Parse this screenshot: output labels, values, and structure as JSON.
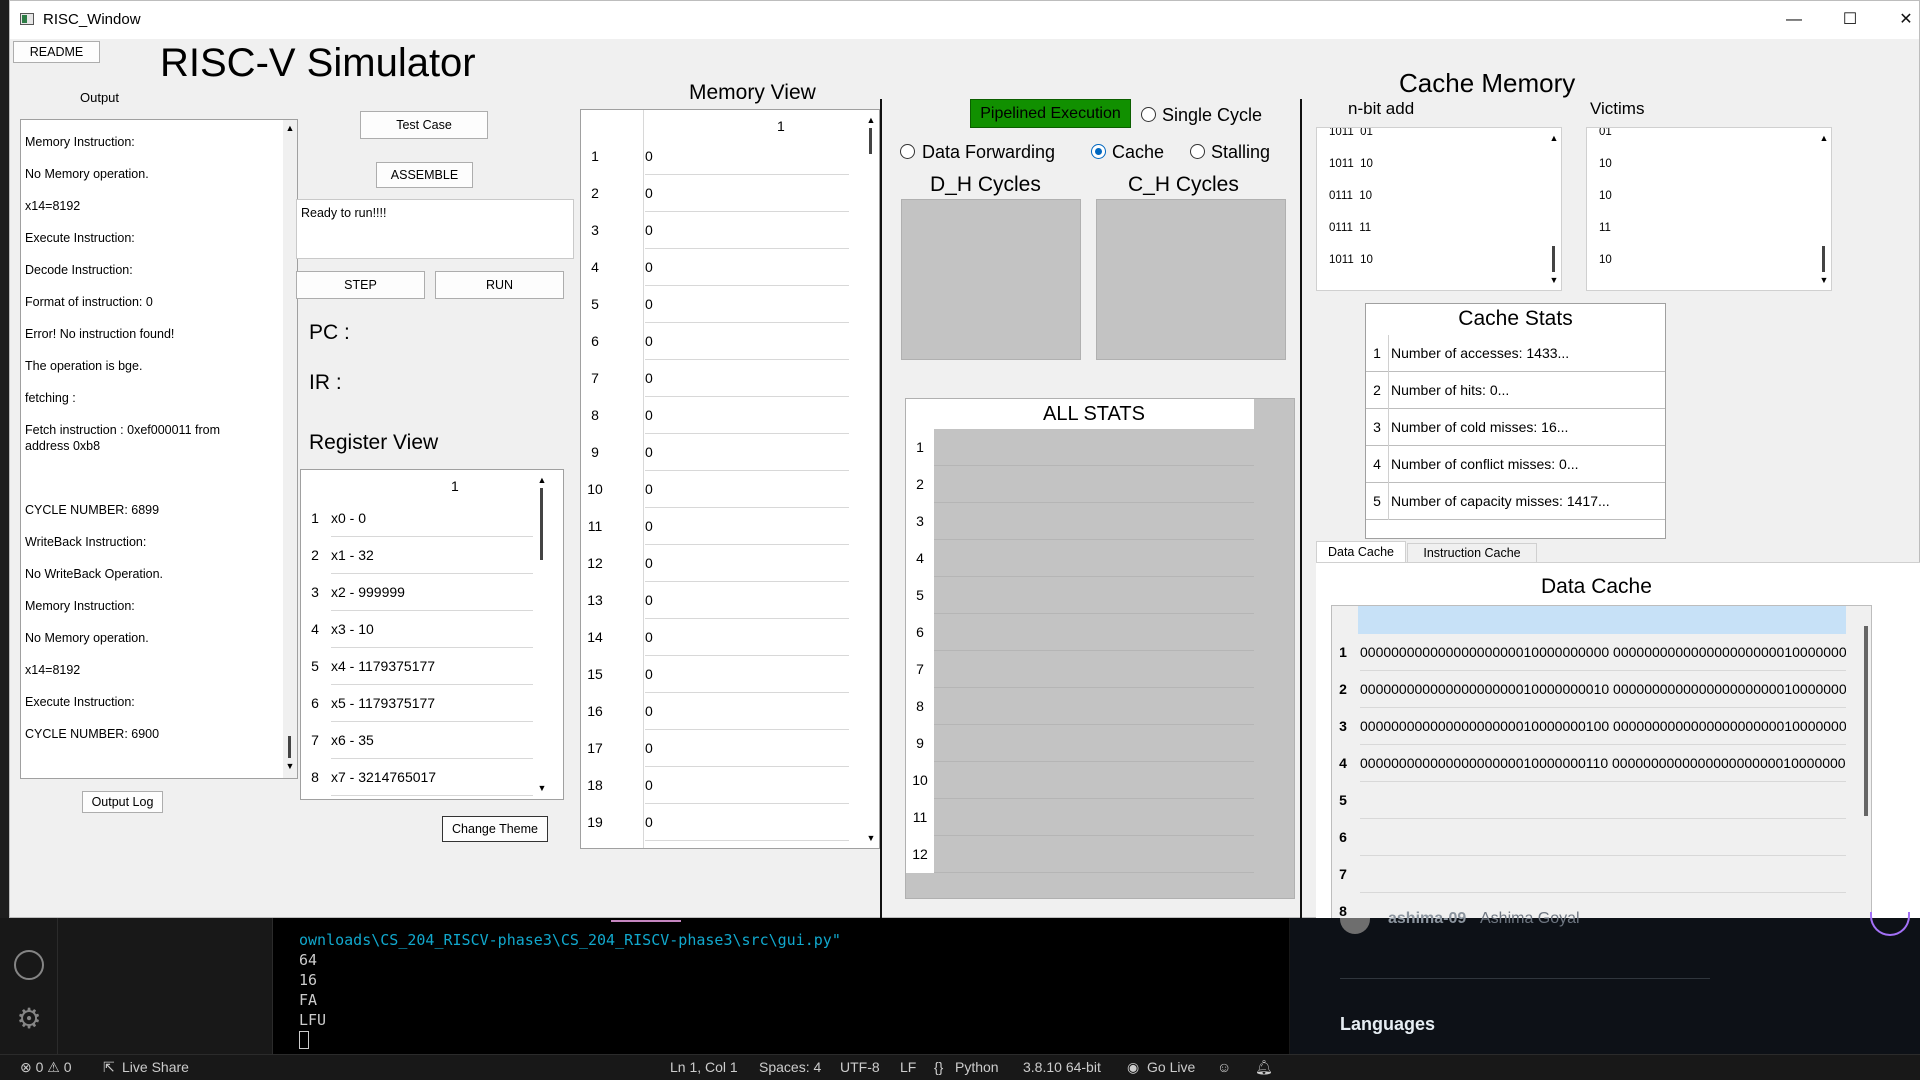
{
  "window": {
    "title": "RISC_Window",
    "minimize": "—",
    "maximize": "☐",
    "close": "✕"
  },
  "app_title": "RISC-V Simulator",
  "left": {
    "readme": "README",
    "output_label": "Output",
    "output_lines": [
      "Memory Instruction:",
      "No Memory operation.",
      "x14=8192",
      "Execute Instruction:",
      "Decode Instruction:",
      "Format of instruction: 0",
      "Error! No instruction found!",
      "The operation is bge.",
      "fetching :",
      "Fetch instruction : 0xef000011 from address 0xb8",
      "CYCLE NUMBER: 6899",
      "WriteBack Instruction:",
      "No WriteBack Operation.",
      "Memory Instruction:",
      "No Memory operation.",
      "x14=8192",
      "Execute Instruction:",
      "CYCLE NUMBER: 6900"
    ],
    "output_log": "Output Log"
  },
  "controls": {
    "test_case": "Test Case",
    "assemble": "ASSEMBLE",
    "status": "Ready to run!!!!",
    "step": "STEP",
    "run": "RUN",
    "pc": "PC :",
    "ir": "IR :",
    "register_view": "Register View",
    "register_col": "1",
    "registers": [
      {
        "n": "1",
        "v": "x0 - 0"
      },
      {
        "n": "2",
        "v": "x1 - 32"
      },
      {
        "n": "3",
        "v": "x2 - 999999"
      },
      {
        "n": "4",
        "v": "x3 - 10"
      },
      {
        "n": "5",
        "v": "x4 - 1179375177"
      },
      {
        "n": "6",
        "v": "x5 - 1179375177"
      },
      {
        "n": "7",
        "v": "x6 - 35"
      },
      {
        "n": "8",
        "v": "x7 - 3214765017"
      }
    ],
    "change_theme": "Change Theme"
  },
  "memory": {
    "title": "Memory View",
    "col": "1",
    "rows": [
      {
        "n": "1",
        "v": "0"
      },
      {
        "n": "2",
        "v": "0"
      },
      {
        "n": "3",
        "v": "0"
      },
      {
        "n": "4",
        "v": "0"
      },
      {
        "n": "5",
        "v": "0"
      },
      {
        "n": "6",
        "v": "0"
      },
      {
        "n": "7",
        "v": "0"
      },
      {
        "n": "8",
        "v": "0"
      },
      {
        "n": "9",
        "v": "0"
      },
      {
        "n": "10",
        "v": "0"
      },
      {
        "n": "11",
        "v": "0"
      },
      {
        "n": "12",
        "v": "0"
      },
      {
        "n": "13",
        "v": "0"
      },
      {
        "n": "14",
        "v": "0"
      },
      {
        "n": "15",
        "v": "0"
      },
      {
        "n": "16",
        "v": "0"
      },
      {
        "n": "17",
        "v": "0"
      },
      {
        "n": "18",
        "v": "0"
      },
      {
        "n": "19",
        "v": "0"
      }
    ]
  },
  "pipeline": {
    "pipelined": "Pipelined Execution",
    "single_cycle": "Single Cycle",
    "data_forwarding": "Data Forwarding",
    "cache": "Cache",
    "stalling": "Stalling",
    "dh_cycles": "D_H Cycles",
    "ch_cycles": "C_H Cycles",
    "all_stats": "ALL STATS",
    "stat_rows": [
      "1",
      "2",
      "3",
      "4",
      "5",
      "6",
      "7",
      "8",
      "9",
      "10",
      "11",
      "12"
    ]
  },
  "cache": {
    "title": "Cache Memory",
    "nbit_label": "n-bit add",
    "victims_label": "Victims",
    "nbit": [
      "1011  01",
      "1011  10",
      "0111  10",
      "0111  11",
      "1011  10"
    ],
    "victims": [
      "01",
      "10",
      "10",
      "11",
      "10"
    ],
    "stats_title": "Cache Stats",
    "stats": [
      {
        "n": "1",
        "v": "Number of accesses: 1433..."
      },
      {
        "n": "2",
        "v": "Number of hits: 0..."
      },
      {
        "n": "3",
        "v": "Number of cold misses: 16..."
      },
      {
        "n": "4",
        "v": "Number of conflict misses: 0..."
      },
      {
        "n": "5",
        "v": "Number of capacity misses: 1417..."
      }
    ],
    "tabs": [
      "Data Cache",
      "Instruction Cache"
    ],
    "table_title": "Data Cache",
    "rows": [
      {
        "n": "1",
        "v": "00000000000000000000010000000000 0000000000000000000000100000000"
      },
      {
        "n": "2",
        "v": "00000000000000000000010000000010 0000000000000000000000100000000"
      },
      {
        "n": "3",
        "v": "00000000000000000000010000000100 0000000000000000000000100000000"
      },
      {
        "n": "4",
        "v": "00000000000000000000010000000110 0000000000000000000000100000000"
      },
      {
        "n": "5",
        "v": ""
      },
      {
        "n": "6",
        "v": ""
      },
      {
        "n": "7",
        "v": ""
      },
      {
        "n": "8",
        "v": ""
      }
    ]
  },
  "terminal": {
    "lines": [
      "ownloads\\CS_204_RISCV-phase3\\CS_204_RISCV-phase3\\src\\gui.py\"",
      "64",
      "16",
      "FA",
      "LFU"
    ],
    "profile_name": "ashima-09",
    "profile_full": "Ashima Goyal",
    "languages": "Languages"
  },
  "statusbar": {
    "problems": "⊗ 0 ⚠ 0",
    "live_share": "Live Share",
    "position": "Ln 1, Col 1",
    "spaces": "Spaces: 4",
    "encoding": "UTF-8",
    "eol": "LF",
    "language": "Python",
    "python_version": "3.8.10 64-bit",
    "go_live": "Go Live"
  },
  "colors": {
    "pipelined_bg": "#119000",
    "accent": "#0067c0",
    "lang_bar": [
      "#e34c7a",
      "#3572a5",
      "#6e6e6e"
    ]
  }
}
